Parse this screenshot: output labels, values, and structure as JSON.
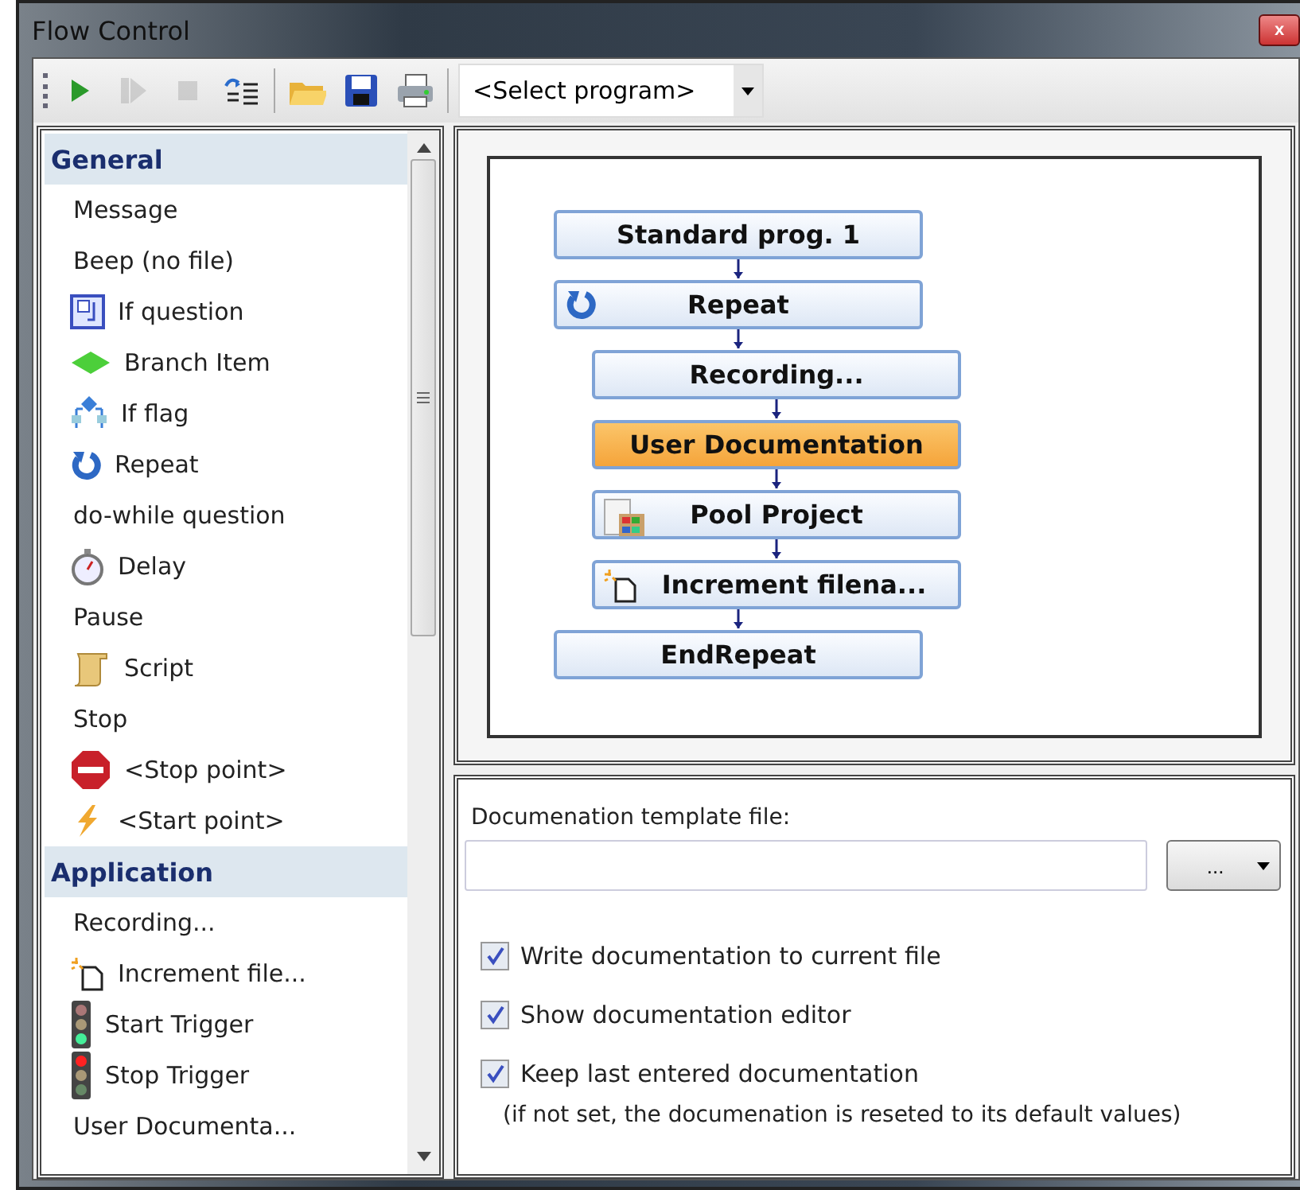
{
  "window": {
    "title": "Flow Control",
    "close_label": "x"
  },
  "toolbar": {
    "buttons": [
      {
        "kind": "play",
        "disabled": false
      },
      {
        "kind": "step",
        "disabled": true
      },
      {
        "kind": "stop",
        "disabled": true
      },
      {
        "kind": "list",
        "disabled": false
      },
      {
        "kind": "open",
        "disabled": false
      },
      {
        "kind": "save",
        "disabled": false
      },
      {
        "kind": "print",
        "disabled": false
      }
    ],
    "program_select": {
      "value": "<Select program>"
    }
  },
  "sidebar": {
    "groups": [
      {
        "title": "General",
        "items": [
          {
            "label": "Message"
          },
          {
            "label": "Beep (no file)"
          },
          {
            "label": "If question",
            "kind": "if-question"
          },
          {
            "label": "Branch Item",
            "kind": "branch"
          },
          {
            "label": "If flag",
            "kind": "if-flag"
          },
          {
            "label": "Repeat",
            "kind": "repeat"
          },
          {
            "label": "do-while question"
          },
          {
            "label": "Delay",
            "kind": "stopwatch"
          },
          {
            "label": "Pause"
          },
          {
            "label": "Script",
            "kind": "scroll"
          },
          {
            "label": "Stop"
          },
          {
            "label": "<Stop point>",
            "kind": "stop-sign"
          },
          {
            "label": "<Start point>",
            "kind": "lightning"
          }
        ]
      },
      {
        "title": "Application",
        "items": [
          {
            "label": "Recording..."
          },
          {
            "label": "Increment file...",
            "kind": "new-file"
          },
          {
            "label": "Start Trigger",
            "kind": "traffic-light-green"
          },
          {
            "label": "Stop Trigger",
            "kind": "traffic-light-red"
          },
          {
            "label": "User Documenta..."
          }
        ]
      }
    ]
  },
  "diagram": {
    "nodes": [
      {
        "label": "Standard prog. 1",
        "selected": false
      },
      {
        "label": "Repeat",
        "kind": "repeat",
        "selected": false,
        "children": [
          {
            "label": "Recording...",
            "selected": false
          },
          {
            "label": "User Documentation",
            "selected": true
          },
          {
            "label": "Pool Project",
            "kind": "pool",
            "selected": false
          },
          {
            "label": "Increment filena...",
            "kind": "new-file",
            "selected": false
          }
        ]
      },
      {
        "label": "EndRepeat",
        "selected": false
      }
    ]
  },
  "settings": {
    "template_label": "Documenation template file:",
    "browse_button": "...",
    "options": [
      {
        "label": "Write documentation to current file",
        "checked": true
      },
      {
        "label": "Show documentation editor",
        "checked": true
      },
      {
        "label": "Keep last entered documentation",
        "checked": true
      }
    ],
    "note": "(if not set, the documenation is reseted to its default values)"
  }
}
